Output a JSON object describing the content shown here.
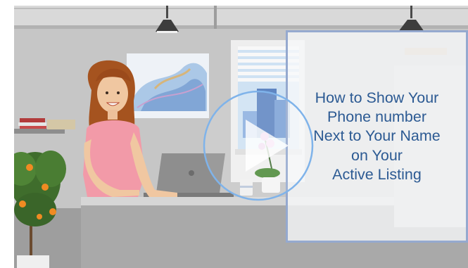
{
  "video": {
    "title": "How to Show Your\nPhone number\nNext to Your Name\non Your\nActive Listing"
  },
  "colors": {
    "title_text": "#2c5a93",
    "panel_border": "#95a9cf",
    "play_icon": "#ffffff",
    "wall": "#c9c9c9",
    "desk": "#a9a9a9"
  },
  "icons": {
    "play": "play-icon"
  }
}
